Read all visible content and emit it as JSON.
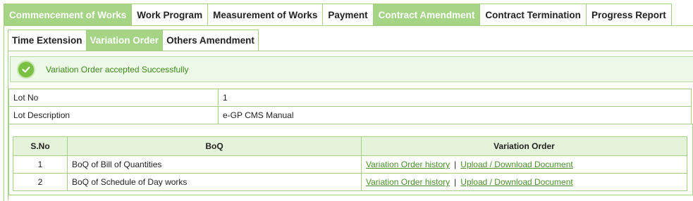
{
  "top_tabs": [
    {
      "label": "Commencement of Works",
      "active": true
    },
    {
      "label": "Work Program",
      "active": false
    },
    {
      "label": "Measurement of Works",
      "active": false
    },
    {
      "label": "Payment",
      "active": false
    },
    {
      "label": "Contract Amendment",
      "active": true
    },
    {
      "label": "Contract Termination",
      "active": false
    },
    {
      "label": "Progress Report",
      "active": false
    }
  ],
  "sub_tabs": [
    {
      "label": "Time Extension",
      "active": false
    },
    {
      "label": "Variation Order",
      "active": true
    },
    {
      "label": "Others Amendment",
      "active": false
    }
  ],
  "message": {
    "icon": "check-circle-icon",
    "text": "Variation Order accepted Successfully"
  },
  "lot": {
    "no_label": "Lot No",
    "no_value": "1",
    "desc_label": "Lot Description",
    "desc_value": "e-GP CMS Manual"
  },
  "boq": {
    "headers": [
      "S.No",
      "BoQ",
      "Variation Order"
    ],
    "rows": [
      {
        "sno": "1",
        "name": "BoQ of Bill of Quantities",
        "link1": "Variation Order history",
        "link2": "Upload / Download Document"
      },
      {
        "sno": "2",
        "name": "BoQ of Schedule of Day works",
        "link1": "Variation Order history",
        "link2": "Upload / Download Document"
      }
    ],
    "separator": "|"
  },
  "colors": {
    "accent": "#a6d485",
    "border": "#a6cf86",
    "success_text": "#3a8a18",
    "link": "#4a8f2a"
  }
}
